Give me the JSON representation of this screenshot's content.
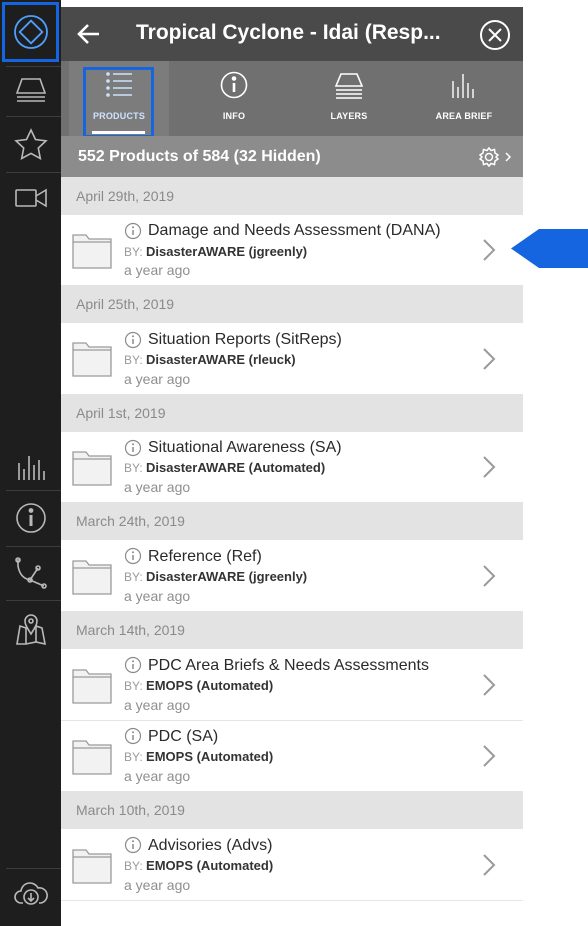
{
  "header": {
    "title": "Tropical Cyclone - Idai (Resp..."
  },
  "tabs": [
    {
      "label": "PRODUCTS",
      "icon": "list-icon",
      "active": true
    },
    {
      "label": "INFO",
      "icon": "info-icon",
      "active": false
    },
    {
      "label": "LAYERS",
      "icon": "layers-icon",
      "active": false
    },
    {
      "label": "AREA BRIEF",
      "icon": "bar-chart-icon",
      "active": false
    }
  ],
  "summary": {
    "text": "552 Products of 584 (32 Hidden)"
  },
  "dates": [
    "April 29th, 2019",
    "April 25th, 2019",
    "April 1st, 2019",
    "March 24th, 2019",
    "March 14th, 2019",
    "March 10th, 2019"
  ],
  "items": [
    {
      "name": "Damage and Needs Assessment (DANA)",
      "by_label": "BY:",
      "author": "DisasterAWARE (jgreenly)",
      "age": "a year ago"
    },
    {
      "name": "Situation Reports (SitReps)",
      "by_label": "BY:",
      "author": "DisasterAWARE (rleuck)",
      "age": "a year ago"
    },
    {
      "name": "Situational Awareness (SA)",
      "by_label": "BY:",
      "author": "DisasterAWARE (Automated)",
      "age": "a year ago"
    },
    {
      "name": "Reference (Ref)",
      "by_label": "BY:",
      "author": "DisasterAWARE (jgreenly)",
      "age": "a year ago"
    },
    {
      "name": "PDC Area Briefs & Needs Assessments",
      "by_label": "BY:",
      "author": "EMOPS (Automated)",
      "age": "a year ago"
    },
    {
      "name": "PDC (SA)",
      "by_label": "BY:",
      "author": "EMOPS (Automated)",
      "age": "a year ago"
    },
    {
      "name": "Advisories (Advs)",
      "by_label": "BY:",
      "author": "EMOPS (Automated)",
      "age": "a year ago"
    }
  ],
  "rail": {
    "icons": [
      "logo-icon",
      "layers-icon",
      "star-icon",
      "video-camera-icon",
      "bar-chart-icon",
      "info-icon",
      "route-icon",
      "map-pin-icon",
      "cloud-download-icon"
    ]
  },
  "colors": {
    "accent": "#1565e0",
    "rail_bg": "#1e1e1e",
    "header_bg": "#4a4a4a",
    "tabs_bg": "#707070",
    "summary_bg": "#8c8c8c",
    "date_bg": "#e3e3e3"
  }
}
